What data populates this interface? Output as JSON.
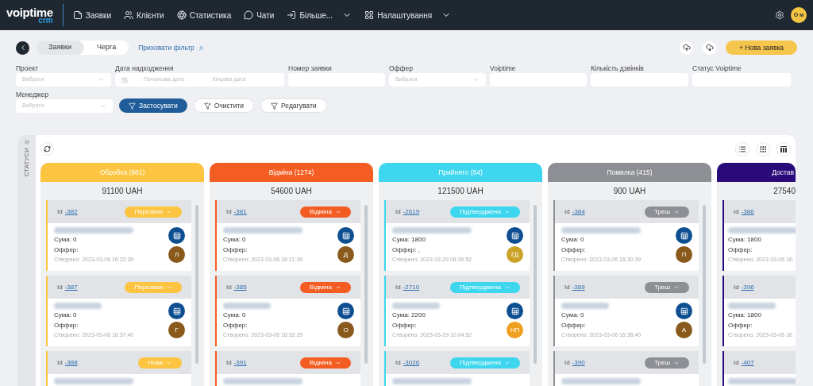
{
  "brand": {
    "name": "voiptime",
    "sub": "crm"
  },
  "nav": [
    {
      "label": "Заявки",
      "dropdown": false
    },
    {
      "label": "Клієнти",
      "dropdown": false
    },
    {
      "label": "Статистика",
      "dropdown": false
    },
    {
      "label": "Чати",
      "dropdown": false
    },
    {
      "label": "Більше...",
      "dropdown": true
    },
    {
      "label": "Налаштування",
      "dropdown": true
    }
  ],
  "user": {
    "initials": "О м"
  },
  "view_tabs": [
    {
      "label": "Заявки",
      "selected": true
    },
    {
      "label": "Черга",
      "selected": false
    }
  ],
  "hide_filter": "Приховати фільтр",
  "new_button": "+ Нова заявка",
  "filters": [
    {
      "label": "Проект",
      "kind": "select",
      "placeholder": "Вибрати"
    },
    {
      "label": "Дата надходження",
      "kind": "daterange",
      "placeholder": "Початкова дата",
      "placeholder_end": "Кінцева дата"
    },
    {
      "label": "Номер заявки",
      "kind": "text"
    },
    {
      "label": "Оффер",
      "kind": "select",
      "placeholder": "Вибрати"
    },
    {
      "label": "Voiptime",
      "kind": "text"
    },
    {
      "label": "Кількість дзвінків",
      "kind": "text"
    },
    {
      "label": "Статус Voiptime",
      "kind": "text"
    }
  ],
  "manager_filter": {
    "label": "Менеджер",
    "placeholder": "Вибрати"
  },
  "actions": [
    {
      "label": "Застосувати",
      "kind": "primary"
    },
    {
      "label": "Очистити",
      "kind": "clear"
    },
    {
      "label": "Редагувати",
      "kind": "edit"
    }
  ],
  "statuses_label": "СТАТУСИ",
  "columns": [
    {
      "title": "Обробка (981)",
      "color": "#fcc440",
      "total": "91100 UAH",
      "cards": [
        {
          "id_label": "Id",
          "id": "-382",
          "status": "Перезвон",
          "sum": "Сума: 0",
          "offer": "Оффер:",
          "created": "Створено: 2023-03-06 16:22:39",
          "initials": "Л",
          "color": "#8a5a1c"
        },
        {
          "id_label": "Id",
          "id": "-387",
          "status": "Перезвон",
          "sum": "Сума: 0",
          "offer": "Оффер:",
          "created": "Створено: 2023-03-06 16:37:40",
          "initials": "Г",
          "color": "#8a5a1c"
        },
        {
          "id_label": "Id",
          "id": "-388",
          "status": "Нова"
        }
      ]
    },
    {
      "title": "Відміна (1274)",
      "color": "#f45d22",
      "total": "54600 UAH",
      "cards": [
        {
          "id_label": "Id",
          "id": "-381",
          "status": "Відміна",
          "sum": "Сума: 0",
          "offer": "Оффер:",
          "created": "Створено: 2023-03-06 16:21:39",
          "initials": "Д",
          "color": "#8a5a1c"
        },
        {
          "id_label": "Id",
          "id": "-385",
          "status": "Відміна",
          "sum": "Сума: 0",
          "offer": "Оффер:",
          "created": "Створено: 2023-03-06 16:32:39",
          "initials": "О",
          "color": "#8a5a1c"
        },
        {
          "id_label": "Id",
          "id": "-391",
          "status": "Відміна"
        }
      ]
    },
    {
      "title": "Прийнято (64)",
      "color": "#3dd6ee",
      "total": "121500 UAH",
      "cards": [
        {
          "id_label": "Id",
          "id": "-2619",
          "status": "Підтверджена",
          "sum": "Сума: 1800",
          "offer": "Оффер: ,",
          "created": "Створено: 2023-03-29 08:39:52",
          "initials": "ГД",
          "color": "#c9a227"
        },
        {
          "id_label": "Id",
          "id": "-2710",
          "status": "Підтверджена",
          "sum": "Сума: 2200",
          "offer": "Оффер:",
          "created": "Створено: 2023-03-29 10:04:52",
          "initials": "НП",
          "color": "#f0a020"
        },
        {
          "id_label": "Id",
          "id": "-3026",
          "status": "Підтверджена"
        }
      ]
    },
    {
      "title": "Помилка (415)",
      "color": "#8d8f95",
      "total": "900 UAH",
      "cards": [
        {
          "id_label": "Id",
          "id": "-384",
          "status": "Треш",
          "sum": "Сума: 0",
          "offer": "Оффер:",
          "created": "Створено: 2023-03-06 16:30:39",
          "initials": "П",
          "color": "#8a5a1c"
        },
        {
          "id_label": "Id",
          "id": "-389",
          "status": "Треш",
          "sum": "Сума: 0",
          "offer": "Оффер:",
          "created": "Створено: 2023-03-06 16:38:40",
          "initials": "А",
          "color": "#8a5a1c"
        },
        {
          "id_label": "Id",
          "id": "-390",
          "status": "Треш"
        }
      ]
    },
    {
      "title": "Достав",
      "color": "#2a0a7a",
      "total": "27540",
      "cards": [
        {
          "id_label": "Id",
          "id": "-386",
          "sum": "Сума: 1800",
          "offer": "Оффер:",
          "created": "Створено: 2023-03-06 16:"
        },
        {
          "id_label": "Id",
          "id": "-396",
          "sum": "Сума: 1800",
          "offer": "Оффер:",
          "created": "Створено: 2023-03-06 16:"
        },
        {
          "id_label": "Id",
          "id": "-407"
        }
      ]
    }
  ]
}
